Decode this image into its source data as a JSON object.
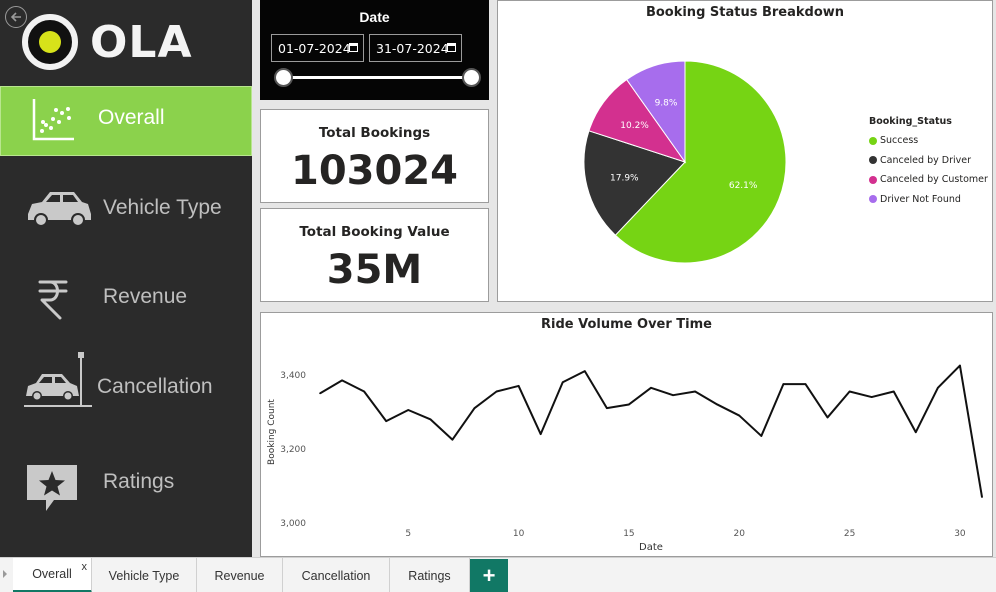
{
  "brand": {
    "logo_text": "OLA"
  },
  "sidebar": {
    "items": [
      {
        "label": "Overall",
        "icon": "scatter-chart-icon",
        "active": true
      },
      {
        "label": "Vehicle Type",
        "icon": "car-icon",
        "active": false
      },
      {
        "label": "Revenue",
        "icon": "rupee-icon",
        "active": false
      },
      {
        "label": "Cancellation",
        "icon": "car-crash-icon",
        "active": false
      },
      {
        "label": "Ratings",
        "icon": "star-speech-bubble-icon",
        "active": false
      }
    ]
  },
  "date_slicer": {
    "title": "Date",
    "start": "01-07-2024",
    "end": "31-07-2024",
    "range_start_fraction": 0.0,
    "range_end_fraction": 1.0
  },
  "kpis": {
    "total_bookings": {
      "title": "Total Bookings",
      "value": "103024"
    },
    "total_booking_value": {
      "title": "Total Booking Value",
      "value": "35M"
    }
  },
  "pie": {
    "title": "Booking Status Breakdown",
    "legend_title": "Booking_Status"
  },
  "line": {
    "title": "Ride Volume Over Time"
  },
  "chart_data": [
    {
      "type": "pie",
      "title": "Booking Status Breakdown",
      "legend_title": "Booking_Status",
      "legend_position": "right",
      "categories": [
        "Success",
        "Canceled by Driver",
        "Canceled by Customer",
        "Driver Not Found"
      ],
      "values": [
        62.1,
        17.9,
        10.2,
        9.8
      ],
      "labels": [
        "62.1%",
        "17.9%",
        "10.2%",
        "9.8%"
      ],
      "colors": [
        "#76d414",
        "#333333",
        "#d3308f",
        "#a76ded"
      ]
    },
    {
      "type": "line",
      "title": "Ride Volume Over Time",
      "xlabel": "Date",
      "ylabel": "Booking Count",
      "x": [
        1,
        2,
        3,
        4,
        5,
        6,
        7,
        8,
        9,
        10,
        11,
        12,
        13,
        14,
        15,
        16,
        17,
        18,
        19,
        20,
        21,
        22,
        23,
        24,
        25,
        26,
        27,
        28,
        29,
        30,
        31
      ],
      "values": [
        3350,
        3385,
        3355,
        3275,
        3305,
        3280,
        3225,
        3310,
        3355,
        3370,
        3240,
        3380,
        3410,
        3310,
        3320,
        3365,
        3345,
        3355,
        3320,
        3290,
        3235,
        3375,
        3375,
        3285,
        3355,
        3340,
        3355,
        3245,
        3365,
        3425,
        3070
      ],
      "xticks": [
        5,
        10,
        15,
        20,
        25,
        30
      ],
      "yticks": [
        "3,000",
        "3,200",
        "3,400"
      ],
      "ytick_values": [
        3000,
        3200,
        3400
      ],
      "ylim": [
        3000,
        3440
      ],
      "xlim": [
        1,
        31
      ],
      "grid": false,
      "line_color": "#111111"
    }
  ],
  "tabs": [
    {
      "label": "Overall",
      "active": true,
      "close": "x"
    },
    {
      "label": "Vehicle Type",
      "active": false
    },
    {
      "label": "Revenue",
      "active": false
    },
    {
      "label": "Cancellation",
      "active": false
    },
    {
      "label": "Ratings",
      "active": false
    }
  ],
  "add_tab": "+"
}
